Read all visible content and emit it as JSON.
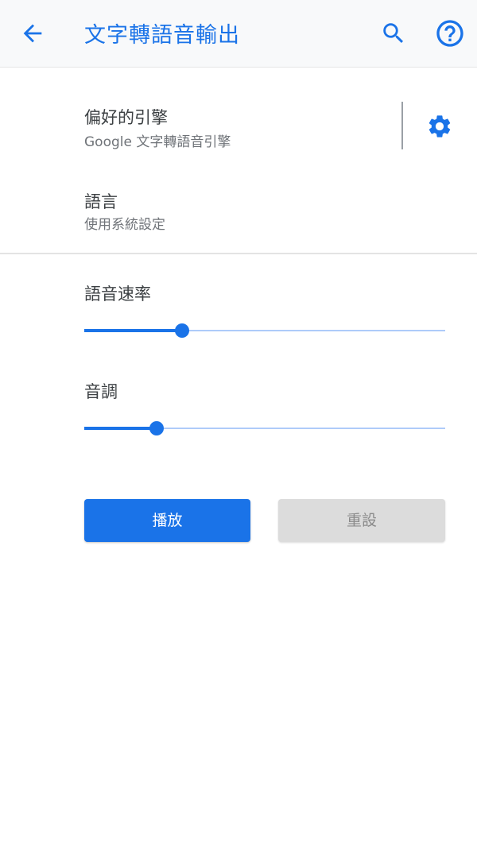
{
  "app_bar": {
    "title": "文字轉語音輸出",
    "back_icon": "arrow-back-icon",
    "search_icon": "search-icon",
    "help_icon": "help-circle-icon"
  },
  "preferences": {
    "engine": {
      "title": "偏好的引擎",
      "summary": "Google 文字轉語音引擎",
      "settings_icon": "gear-icon"
    },
    "language": {
      "title": "語言",
      "summary": "使用系統設定"
    }
  },
  "sliders": {
    "speech_rate": {
      "label": "語音速率",
      "value_fraction": 0.27
    },
    "pitch": {
      "label": "音調",
      "value_fraction": 0.2
    }
  },
  "buttons": {
    "play_label": "播放",
    "reset_label": "重設"
  },
  "colors": {
    "accent": "#1a73e8",
    "track_inactive": "#aecbfa",
    "reset_button_bg": "#dcdcdc"
  }
}
